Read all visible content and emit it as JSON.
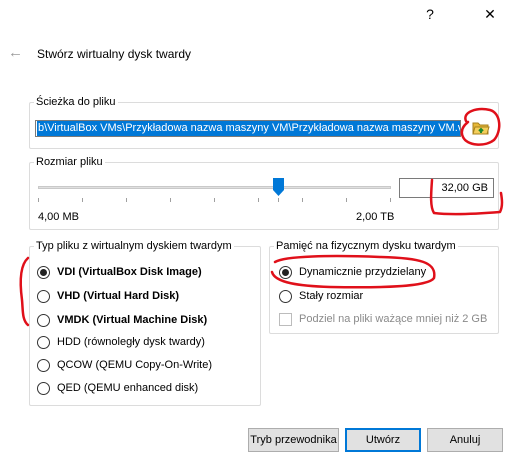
{
  "titlebar": {
    "help": "?",
    "close": "✕"
  },
  "header": {
    "title": "Stwórz wirtualny dysk twardy"
  },
  "path_group": {
    "legend": "Ścieżka do pliku",
    "value": "b\\VirtualBox VMs\\Przykładowa nazwa maszyny VM\\Przykładowa nazwa maszyny VM.vdi"
  },
  "size_group": {
    "legend": "Rozmiar pliku",
    "value": "32,00 GB",
    "min_label": "4,00 MB",
    "max_label": "2,00 TB"
  },
  "type_group": {
    "legend": "Typ pliku z wirtualnym dyskiem twardym",
    "options": [
      {
        "label": "VDI (VirtualBox Disk Image)",
        "checked": true
      },
      {
        "label": "VHD (Virtual Hard Disk)",
        "checked": false
      },
      {
        "label": "VMDK (Virtual Machine Disk)",
        "checked": false
      },
      {
        "label": "HDD (równoległy dysk twardy)",
        "checked": false
      },
      {
        "label": "QCOW (QEMU Copy-On-Write)",
        "checked": false
      },
      {
        "label": "QED (QEMU enhanced disk)",
        "checked": false
      }
    ]
  },
  "storage_group": {
    "legend": "Pamięć na fizycznym dysku twardym",
    "options": [
      {
        "label": "Dynamicznie przydzielany",
        "checked": true
      },
      {
        "label": "Stały rozmiar",
        "checked": false
      }
    ],
    "split_label": "Podziel na pliki ważące mniej niż 2 GB"
  },
  "buttons": {
    "guided": "Tryb przewodnika",
    "create": "Utwórz",
    "cancel": "Anuluj"
  },
  "colors": {
    "selection": "#0078d7",
    "annotation": "#e0101a",
    "slider_handle": "#0078d7"
  },
  "icons": {
    "folder": "folder-open-icon",
    "back": "back-arrow-icon"
  }
}
